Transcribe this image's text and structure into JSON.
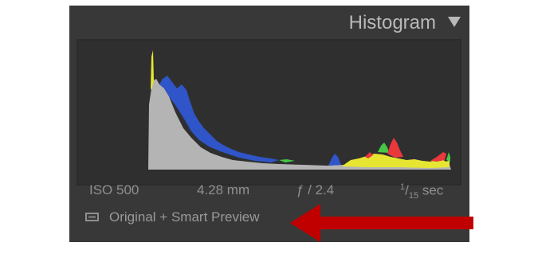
{
  "panel": {
    "title": "Histogram",
    "collapse_icon": "triangle-down-icon"
  },
  "exif": {
    "iso": "ISO 500",
    "focal_length": "4.28 mm",
    "aperture": "ƒ / 2.4",
    "shutter_numerator": "1",
    "shutter_denominator": "15",
    "shutter_unit": "sec"
  },
  "source": {
    "icon": "preview-rectangle-icon",
    "label": "Original + Smart Preview"
  },
  "annotation": {
    "icon": "red-arrow-left-icon",
    "color": "#c00000"
  },
  "colors": {
    "panel_bg": "#383838",
    "histogram_bg": "#2f2f2f",
    "text": "#8f8f8f",
    "luminance": "#b4b4b4",
    "blue": "#2f55c8",
    "red": "#e8383c",
    "yellow": "#e6e632",
    "green": "#46c846"
  }
}
